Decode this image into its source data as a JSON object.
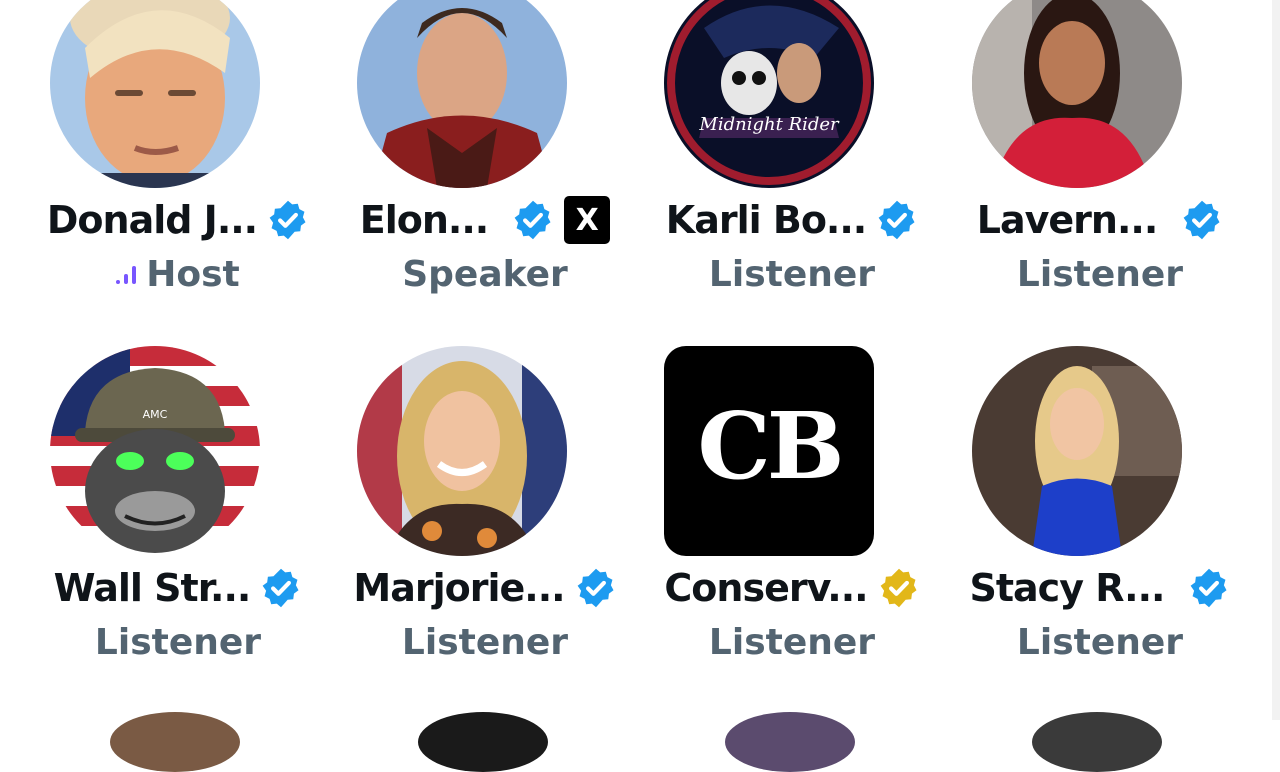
{
  "participants": [
    {
      "name": "Donald J...",
      "role": "Host",
      "badge": "blue",
      "host": true
    },
    {
      "name": "Elon...",
      "role": "Speaker",
      "badge": "blue",
      "affiliation": "X"
    },
    {
      "name": "Karli Bo...",
      "role": "Listener",
      "badge": "blue"
    },
    {
      "name": "Lavern...",
      "role": "Listener",
      "badge": "blue"
    },
    {
      "name": "Wall Str...",
      "role": "Listener",
      "badge": "blue"
    },
    {
      "name": "Marjorie...",
      "role": "Listener",
      "badge": "blue"
    },
    {
      "name": "Conserv...",
      "role": "Listener",
      "badge": "gold"
    },
    {
      "name": "Stacy R...",
      "role": "Listener",
      "badge": "blue"
    }
  ],
  "avatar_texts": {
    "karli": "Midnight Rider",
    "cb": "CB",
    "ape": "AMC"
  },
  "colors": {
    "blue_badge": "#1d9bf0",
    "gold_badge": "#e2b719",
    "host_icon": "#7856ff",
    "role_text": "#536471",
    "name_text": "#0f1419"
  }
}
